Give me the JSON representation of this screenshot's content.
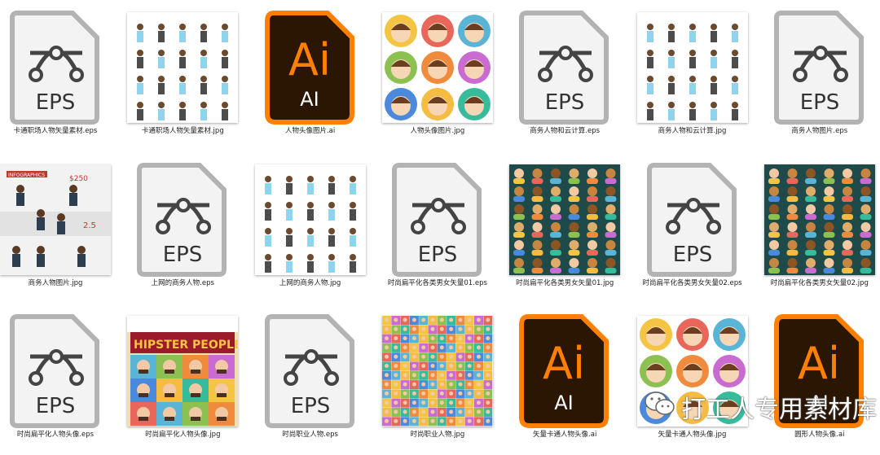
{
  "files": [
    {
      "name": "卡通职场人物矢量素材.eps",
      "type": "eps"
    },
    {
      "name": "卡通职场人物矢量素材.jpg",
      "type": "jpg",
      "style": "office-scene"
    },
    {
      "name": "人物头像图片.ai",
      "type": "ai"
    },
    {
      "name": "人物头像图片.jpg",
      "type": "jpg",
      "style": "avatar-circles"
    },
    {
      "name": "商务人物和云计算.eps",
      "type": "eps"
    },
    {
      "name": "商务人物和云计算.jpg",
      "type": "jpg",
      "style": "office-scene"
    },
    {
      "name": "商务人物图片.eps",
      "type": "eps"
    },
    {
      "name": "商务人物图片.jpg",
      "type": "jpg",
      "style": "infographic",
      "thumb_text": "INFOGRAPHICS"
    },
    {
      "name": "上网的商务人物.eps",
      "type": "eps"
    },
    {
      "name": "上网的商务人物.jpg",
      "type": "jpg",
      "style": "office-scene"
    },
    {
      "name": "时尚扁平化各类男女矢量01.eps",
      "type": "eps"
    },
    {
      "name": "时尚扁平化各类男女矢量01.jpg",
      "type": "jpg",
      "style": "dark-avatars"
    },
    {
      "name": "时尚扁平化各类男女矢量02.eps",
      "type": "eps"
    },
    {
      "name": "时尚扁平化各类男女矢量02.jpg",
      "type": "jpg",
      "style": "dark-avatars"
    },
    {
      "name": "时尚扁平化人物头像.eps",
      "type": "eps"
    },
    {
      "name": "时尚扁平化人物头像.jpg",
      "type": "jpg",
      "style": "hipster",
      "thumb_text": "HIPSTER PEOPLE"
    },
    {
      "name": "时尚职业人物.eps",
      "type": "eps"
    },
    {
      "name": "时尚职业人物.jpg",
      "type": "jpg",
      "style": "colorful-grid"
    },
    {
      "name": "矢量卡通人物头像.ai",
      "type": "ai"
    },
    {
      "name": "矢量卡通人物头像.jpg",
      "type": "jpg",
      "style": "avatar-circles"
    },
    {
      "name": "圆形人物头像.ai",
      "type": "ai"
    }
  ],
  "icon_text": {
    "eps": "EPS",
    "ai_big": "Ai",
    "ai_small": "AI"
  },
  "colors": {
    "ai_fill": "#2b1503",
    "ai_accent": "#ff7f00",
    "eps_stroke": "#b3b3b3",
    "eps_fill": "#f3f3f3",
    "dark_bg": "#1f4a4a"
  },
  "watermark": {
    "text": "打工人专用素材库",
    "icon": "wechat-icon"
  }
}
